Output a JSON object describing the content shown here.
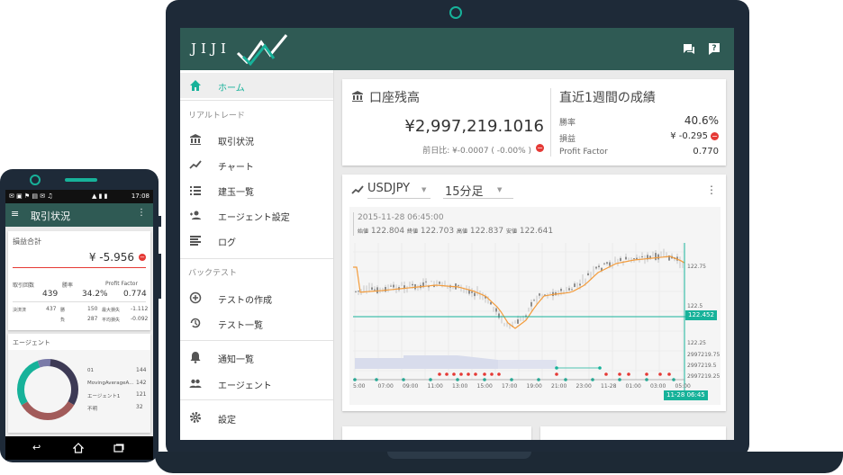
{
  "laptop": {
    "header": {
      "logo": "JIJI",
      "icons": [
        "chat-icon",
        "help-icon"
      ]
    },
    "sidebar": {
      "home": "ホーム",
      "section_real": "リアルトレード",
      "real_items": [
        "取引状況",
        "チャート",
        "建玉一覧",
        "エージェント設定",
        "ログ"
      ],
      "section_back": "バックテスト",
      "back_items": [
        "テストの作成",
        "テスト一覧"
      ],
      "other_items": [
        "通知一覧",
        "エージェント"
      ],
      "settings": "設定"
    },
    "balance": {
      "title": "口座残高",
      "amount": "¥2,997,219.1016",
      "prev": "前日比: ¥-0.0007 ( -0.00% )"
    },
    "weekly": {
      "title": "直近1週間の成績",
      "rows": [
        {
          "label": "勝率",
          "value": "40.6%"
        },
        {
          "label": "損益",
          "value": "¥ -0.295"
        },
        {
          "label": "Profit Factor",
          "value": "0.770"
        }
      ]
    },
    "chart": {
      "pair": "USDJPY",
      "interval": "15分足",
      "datetime": "2015-11-28 06:45:00",
      "ohlc": [
        {
          "label": "始値",
          "value": "122.804"
        },
        {
          "label": "終値",
          "value": "122.703"
        },
        {
          "label": "高値",
          "value": "122.837"
        },
        {
          "label": "安値",
          "value": "122.641"
        }
      ],
      "price_ticks": [
        "122.75",
        "122.5",
        "122.25"
      ],
      "current_price": "122.452",
      "balance_ticks": [
        "2997219.75",
        "2997219.5",
        "2997219.25"
      ],
      "time_ticks": [
        "5:00",
        "07:00",
        "09:00",
        "11:00",
        "13:00",
        "15:00",
        "17:00",
        "19:00",
        "21:00",
        "23:00",
        "11-28",
        "01:00",
        "03:00",
        "05:00"
      ],
      "cursor_time": "11-28 06:45"
    }
  },
  "phone": {
    "status_time": "17:08",
    "title": "取引状況",
    "pnl": {
      "title": "損益合計",
      "amount": "¥ -5.956",
      "headers": [
        "取引回数",
        "勝率",
        "Profit Factor"
      ],
      "values": [
        "439",
        "34.2%",
        "0.774"
      ],
      "details": [
        {
          "l1": "決済済",
          "v1": "437",
          "l2": "勝",
          "v2": "150",
          "l3": "最大損失",
          "v3": "-1.112"
        },
        {
          "l1": "",
          "v1": "",
          "l2": "負",
          "v2": "287",
          "l3": "平均損失",
          "v3": "-0.092"
        }
      ]
    },
    "agents": {
      "title": "エージェント",
      "items": [
        {
          "name": "01",
          "value": "144"
        },
        {
          "name": "MovingAverageA...",
          "value": "142"
        },
        {
          "name": "エージェント1",
          "value": "121"
        },
        {
          "name": "不明",
          "value": "32"
        }
      ]
    }
  },
  "colors": {
    "accent": "#17b29a",
    "header": "#2f5a54",
    "bezel": "#1e2a38",
    "negative": "#e53935",
    "ma_orange": "#f39c3c"
  }
}
